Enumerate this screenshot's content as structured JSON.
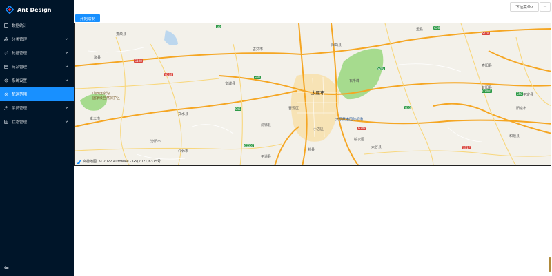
{
  "app": {
    "title": "Ant Design"
  },
  "sidebar": {
    "items": [
      {
        "label": "数据统计",
        "icon": "dashboard-icon",
        "has_arrow": false,
        "active": false
      },
      {
        "label": "分类管理",
        "icon": "apartment-icon",
        "has_arrow": true,
        "active": false
      },
      {
        "label": "轮播管理",
        "icon": "swap-icon",
        "has_arrow": true,
        "active": false
      },
      {
        "label": "商品管理",
        "icon": "goods-icon",
        "has_arrow": true,
        "active": false
      },
      {
        "label": "系统设置",
        "icon": "setting-icon",
        "has_arrow": true,
        "active": false
      },
      {
        "label": "配送范围",
        "icon": "gear-icon",
        "has_arrow": false,
        "active": true
      },
      {
        "label": "学员管理",
        "icon": "user-icon",
        "has_arrow": true,
        "active": false
      },
      {
        "label": "状态管理",
        "icon": "table-icon",
        "has_arrow": true,
        "active": false
      }
    ]
  },
  "header": {
    "dropdown_label": "下拉菜单2",
    "more_label": "···"
  },
  "toolbar": {
    "draw_label": "开始绘制"
  },
  "map": {
    "city": "太原市",
    "labels": [
      "娄烦县",
      "岚县",
      "古交市",
      "交城县",
      "文水县",
      "清徐县",
      "晋源区",
      "小店区",
      "榆次区",
      "阳曲县",
      "寿阳县",
      "太谷县",
      "祁县",
      "平遥县",
      "汾阳市",
      "孝义市",
      "介休市",
      "盂县",
      "平定县",
      "和顺县",
      "昔阳县",
      "阳泉市",
      "石千峰"
    ],
    "pois": [
      "山西庞泉沟",
      "国家级自然保护区"
    ],
    "airport": "太原武宿国际机场",
    "road_badges": [
      "G5",
      "G20",
      "G55",
      "G108",
      "G208",
      "G307",
      "S45",
      "S60",
      "S50",
      "S202",
      "G2001",
      "G5501",
      "S104",
      "S317"
    ],
    "attribution_logo": "高德地图",
    "attribution_text": "© 2022 AutoNavi - GS(2021)6375号"
  },
  "colors": {
    "sidebar_bg": "#001529",
    "accent": "#1890ff",
    "road_major": "#f5a623",
    "park": "#9ed98a"
  }
}
